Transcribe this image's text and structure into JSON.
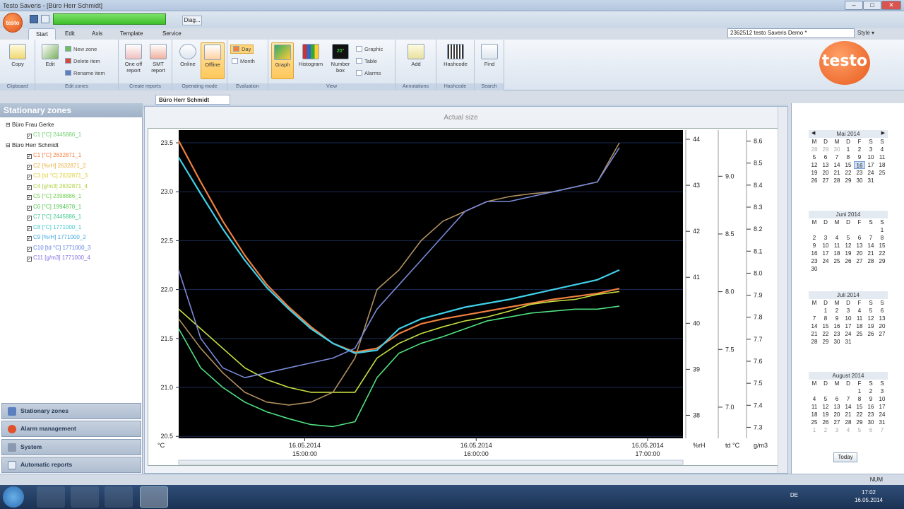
{
  "window": {
    "title": "Testo Saveris - [Büro Herr Schmidt]",
    "min": "–",
    "max": "□",
    "close": "✕"
  },
  "qat": {
    "logo": "testo",
    "diag": "Diag..."
  },
  "tabs": [
    {
      "label": "Start"
    },
    {
      "label": "Edit"
    },
    {
      "label": "Axis"
    },
    {
      "label": "Template"
    },
    {
      "label": "Service"
    }
  ],
  "project": {
    "value": "2362512 testo Saveris Demo *",
    "style": "Style ▾"
  },
  "ribbon": {
    "copy": "Copy",
    "edit": "Edit",
    "new_zone": "New zone",
    "delete_item": "Delete item",
    "rename_item": "Rename item",
    "one_off": "One off report",
    "smt": "SMT report",
    "online": "Online",
    "offline": "Offline",
    "day": "Day",
    "month": "Month",
    "graph": "Graph",
    "histogram": "Histogram",
    "number_box": "Number box",
    "graphic": "Graphic",
    "table": "Table",
    "alarms": "Alarms",
    "add": "Add",
    "hashcode": "Hashcode",
    "find": "Find",
    "groups": [
      "Clipboard",
      "Edit zones",
      "Create reports",
      "Operating mode",
      "Evaluation",
      "View",
      "Annotations",
      "Hashcode",
      "Search"
    ]
  },
  "brand_logo": "testo",
  "left": {
    "title": "Stationary zones",
    "zones": [
      {
        "name": "Büro Frau Gerke",
        "channels": [
          {
            "label": "C1 [°C] 2445886_1",
            "color": "#6fd06f"
          }
        ]
      },
      {
        "name": "Büro Herr Schmidt",
        "channels": [
          {
            "label": "C1 [°C] 2632871_1",
            "color": "#f08040"
          },
          {
            "label": "C2 [%rH] 2632871_2",
            "color": "#e8b040"
          },
          {
            "label": "C3 [td °C] 2632871_3",
            "color": "#e0d040"
          },
          {
            "label": "C4 [g/m3] 2632871_4",
            "color": "#b0d040"
          },
          {
            "label": "C5 [°C] 2398886_1",
            "color": "#70d050"
          },
          {
            "label": "C6 [°C] 1994878_1",
            "color": "#50c850"
          },
          {
            "label": "C7 [°C] 2445886_1",
            "color": "#40c890"
          },
          {
            "label": "C8 [°C] 1771000_1",
            "color": "#40c8d0"
          },
          {
            "label": "C9 [%rH] 1771000_2",
            "color": "#40a8e0"
          },
          {
            "label": "C10 [td °C] 1771000_3",
            "color": "#6080e0"
          },
          {
            "label": "C11 [g/m3] 1771000_4",
            "color": "#8070e0"
          }
        ]
      }
    ],
    "nav": [
      "Stationary zones",
      "Alarm management",
      "System",
      "Automatic reports"
    ]
  },
  "doc": {
    "tab": "Büro Herr Schmidt",
    "actual_size": "Actual size"
  },
  "chart_data": {
    "type": "line",
    "x_ticks": [
      {
        "date": "16.05.2014",
        "time": "15:00:00"
      },
      {
        "date": "16.05.2014",
        "time": "16:00:00"
      },
      {
        "date": "16.05.2014",
        "time": "17:00:00"
      }
    ],
    "xlim": [
      "16.05.2014 14:42",
      "16.05.2014 17:07"
    ],
    "axes": [
      {
        "unit": "°C",
        "ticks": [
          "23.5",
          "23.0",
          "22.5",
          "22.0",
          "21.5",
          "21.0",
          "20.5"
        ],
        "ylim": [
          20.48,
          23.63
        ]
      },
      {
        "unit": "%rH",
        "ticks": [
          "44",
          "43",
          "42",
          "41",
          "40",
          "39",
          "38"
        ],
        "ylim": [
          37.5,
          44.2
        ]
      },
      {
        "unit": "td °C",
        "ticks": [
          "9.0",
          "8.5",
          "8.0",
          "7.5",
          "7.0"
        ],
        "ylim": [
          6.73,
          9.4
        ]
      },
      {
        "unit": "g/m3",
        "ticks": [
          "8.6",
          "8.5",
          "8.4",
          "8.3",
          "8.2",
          "8.1",
          "8.0",
          "7.9",
          "7.8",
          "7.7",
          "7.6",
          "7.5",
          "7.4",
          "7.3"
        ],
        "ylim": [
          7.25,
          8.65
        ]
      }
    ],
    "x": [
      0,
      5,
      10,
      15,
      20,
      25,
      30,
      35,
      40,
      45,
      50,
      55,
      60,
      65,
      70,
      75,
      80,
      85,
      90,
      95,
      100
    ],
    "series": [
      {
        "color": "#f08040",
        "values": [
          23.52,
          23.1,
          22.7,
          22.35,
          22.05,
          21.82,
          21.62,
          21.45,
          21.36,
          21.4,
          21.55,
          21.65,
          21.7,
          21.74,
          21.78,
          21.82,
          21.86,
          21.9,
          21.93,
          21.96,
          22.01
        ]
      },
      {
        "color": "#40d0e8",
        "values": [
          23.35,
          22.98,
          22.62,
          22.3,
          22.02,
          21.8,
          21.6,
          21.45,
          21.35,
          21.38,
          21.6,
          21.7,
          21.76,
          21.82,
          21.86,
          21.9,
          21.95,
          22.0,
          22.05,
          22.1,
          22.2
        ]
      },
      {
        "color": "#c8e040",
        "values": [
          21.8,
          21.6,
          21.4,
          21.2,
          21.08,
          21.0,
          20.95,
          20.95,
          20.95,
          21.3,
          21.45,
          21.55,
          21.62,
          21.68,
          21.72,
          21.78,
          21.85,
          21.88,
          21.9,
          21.95,
          21.98
        ]
      },
      {
        "color": "#50e080",
        "values": [
          21.6,
          21.2,
          21.0,
          20.85,
          20.75,
          20.68,
          20.62,
          20.6,
          20.65,
          21.1,
          21.35,
          21.45,
          21.52,
          21.6,
          21.68,
          21.72,
          21.76,
          21.78,
          21.8,
          21.8,
          21.83
        ]
      },
      {
        "color": "#b09060",
        "values": [
          21.7,
          21.4,
          21.15,
          20.95,
          20.85,
          20.82,
          20.85,
          20.95,
          21.3,
          22.0,
          22.2,
          22.5,
          22.7,
          22.8,
          22.9,
          22.95,
          22.98,
          23.0,
          23.05,
          23.1,
          23.5
        ]
      },
      {
        "color": "#7a8ad8",
        "values": [
          22.2,
          21.5,
          21.2,
          21.1,
          21.15,
          21.2,
          21.25,
          21.3,
          21.4,
          21.8,
          22.05,
          22.3,
          22.55,
          22.8,
          22.9,
          22.9,
          22.95,
          23.0,
          23.05,
          23.1,
          23.45
        ]
      }
    ]
  },
  "calendar": {
    "dow": [
      "M",
      "D",
      "M",
      "D",
      "F",
      "S",
      "S"
    ],
    "months": [
      {
        "name": "Mai 2014",
        "weeks": [
          [
            "28",
            "29",
            "30",
            "1",
            "2",
            "3",
            "4"
          ],
          [
            "5",
            "6",
            "7",
            "8",
            "9",
            "10",
            "11"
          ],
          [
            "12",
            "13",
            "14",
            "15",
            "16",
            "17",
            "18"
          ],
          [
            "19",
            "20",
            "21",
            "22",
            "23",
            "24",
            "25"
          ],
          [
            "26",
            "27",
            "28",
            "29",
            "30",
            "31",
            ""
          ]
        ]
      },
      {
        "name": "Juni 2014",
        "weeks": [
          [
            "",
            "",
            "",
            "",
            "",
            "",
            "1"
          ],
          [
            "2",
            "3",
            "4",
            "5",
            "6",
            "7",
            "8"
          ],
          [
            "9",
            "10",
            "11",
            "12",
            "13",
            "14",
            "15"
          ],
          [
            "16",
            "17",
            "18",
            "19",
            "20",
            "21",
            "22"
          ],
          [
            "23",
            "24",
            "25",
            "26",
            "27",
            "28",
            "29"
          ],
          [
            "30",
            "",
            "",
            "",
            "",
            "",
            ""
          ]
        ]
      },
      {
        "name": "Juli 2014",
        "weeks": [
          [
            "",
            "1",
            "2",
            "3",
            "4",
            "5",
            "6"
          ],
          [
            "7",
            "8",
            "9",
            "10",
            "11",
            "12",
            "13"
          ],
          [
            "14",
            "15",
            "16",
            "17",
            "18",
            "19",
            "20"
          ],
          [
            "21",
            "22",
            "23",
            "24",
            "25",
            "26",
            "27"
          ],
          [
            "28",
            "29",
            "30",
            "31",
            "",
            "",
            ""
          ]
        ]
      },
      {
        "name": "August 2014",
        "weeks": [
          [
            "",
            "",
            "",
            "",
            "1",
            "2",
            "3"
          ],
          [
            "4",
            "5",
            "6",
            "7",
            "8",
            "9",
            "10"
          ],
          [
            "11",
            "12",
            "13",
            "14",
            "15",
            "16",
            "17"
          ],
          [
            "18",
            "19",
            "20",
            "21",
            "22",
            "23",
            "24"
          ],
          [
            "25",
            "26",
            "27",
            "28",
            "29",
            "30",
            "31"
          ],
          [
            "1",
            "2",
            "3",
            "4",
            "5",
            "6",
            "7"
          ]
        ]
      }
    ],
    "today": "Today",
    "prev": "◀",
    "next": "▶"
  },
  "status": {
    "num": "NUM"
  },
  "taskbar": {
    "lang": "DE",
    "time": "17:02",
    "date": "16.05.2014"
  }
}
